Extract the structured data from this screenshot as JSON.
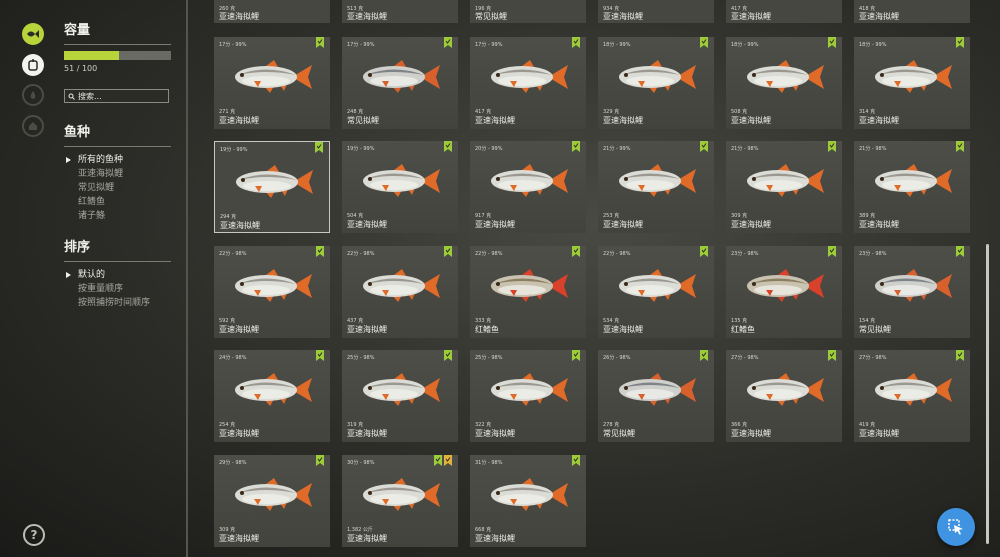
{
  "rail": {
    "icons": [
      "fish-tab-icon",
      "keepnet-icon",
      "fire-icon",
      "home-icon"
    ],
    "help_label": "?"
  },
  "capacity": {
    "title": "容量",
    "current": 51,
    "max": 100,
    "count_text": "51 / 100",
    "fill_fraction": 0.51
  },
  "search": {
    "placeholder": "搜索..."
  },
  "species_filter": {
    "title": "鱼种",
    "options": [
      "所有的鱼种",
      "亚速海拟鲤",
      "常见拟鲤",
      "红鳍鱼",
      "诸子鲦"
    ],
    "selected_index": 0
  },
  "sort": {
    "title": "排序",
    "options": [
      "默认的",
      "按重量顺序",
      "按照捕捞时间顺序"
    ],
    "selected_index": 0
  },
  "colors": {
    "accent": "#b7d43b",
    "cursor_button": "#3f93e0"
  },
  "top_row": [
    {
      "weight": "260 克",
      "species": "亚速海拟鲤"
    },
    {
      "weight": "513 克",
      "species": "亚速海拟鲤"
    },
    {
      "weight": "196 克",
      "species": "常见拟鲤"
    },
    {
      "weight": "934 克",
      "species": "亚速海拟鲤"
    },
    {
      "weight": "417 克",
      "species": "亚速海拟鲤"
    },
    {
      "weight": "418 克",
      "species": "亚速海拟鲤"
    }
  ],
  "catches": [
    {
      "time": "17分 - 99%",
      "weight": "271 克",
      "species": "亚速海拟鲤",
      "badges": [
        "green"
      ]
    },
    {
      "time": "17分 - 99%",
      "weight": "248 克",
      "species": "常见拟鲤",
      "badges": [
        "green"
      ]
    },
    {
      "time": "17分 - 99%",
      "weight": "417 克",
      "species": "亚速海拟鲤",
      "badges": [
        "green"
      ]
    },
    {
      "time": "18分 - 99%",
      "weight": "329 克",
      "species": "亚速海拟鲤",
      "badges": [
        "green"
      ]
    },
    {
      "time": "18分 - 99%",
      "weight": "508 克",
      "species": "亚速海拟鲤",
      "badges": [
        "green"
      ]
    },
    {
      "time": "18分 - 99%",
      "weight": "314 克",
      "species": "亚速海拟鲤",
      "badges": [
        "green"
      ]
    },
    {
      "time": "19分 - 99%",
      "weight": "294 克",
      "species": "亚速海拟鲤",
      "badges": [
        "green"
      ],
      "selected": true
    },
    {
      "time": "19分 - 99%",
      "weight": "504 克",
      "species": "亚速海拟鲤",
      "badges": [
        "green"
      ]
    },
    {
      "time": "20分 - 99%",
      "weight": "917 克",
      "species": "亚速海拟鲤",
      "badges": [
        "green"
      ]
    },
    {
      "time": "21分 - 99%",
      "weight": "253 克",
      "species": "亚速海拟鲤",
      "badges": [
        "green"
      ]
    },
    {
      "time": "21分 - 98%",
      "weight": "309 克",
      "species": "亚速海拟鲤",
      "badges": [
        "green"
      ]
    },
    {
      "time": "21分 - 98%",
      "weight": "389 克",
      "species": "亚速海拟鲤",
      "badges": [
        "green"
      ]
    },
    {
      "time": "22分 - 98%",
      "weight": "592 克",
      "species": "亚速海拟鲤",
      "badges": [
        "green"
      ]
    },
    {
      "time": "22分 - 98%",
      "weight": "437 克",
      "species": "亚速海拟鲤",
      "badges": [
        "green"
      ]
    },
    {
      "time": "22分 - 98%",
      "weight": "333 克",
      "species": "红鳍鱼",
      "badges": [
        "green"
      ]
    },
    {
      "time": "22分 - 98%",
      "weight": "534 克",
      "species": "亚速海拟鲤",
      "badges": [
        "green"
      ]
    },
    {
      "time": "23分 - 98%",
      "weight": "135 克",
      "species": "红鳍鱼",
      "badges": [
        "green"
      ]
    },
    {
      "time": "23分 - 98%",
      "weight": "154 克",
      "species": "常见拟鲤",
      "badges": [
        "green"
      ]
    },
    {
      "time": "24分 - 98%",
      "weight": "254 克",
      "species": "亚速海拟鲤",
      "badges": [
        "green"
      ]
    },
    {
      "time": "25分 - 98%",
      "weight": "319 克",
      "species": "亚速海拟鲤",
      "badges": [
        "green"
      ]
    },
    {
      "time": "25分 - 98%",
      "weight": "322 克",
      "species": "亚速海拟鲤",
      "badges": [
        "green"
      ]
    },
    {
      "time": "26分 - 98%",
      "weight": "278 克",
      "species": "常见拟鲤",
      "badges": [
        "green"
      ]
    },
    {
      "time": "27分 - 98%",
      "weight": "366 克",
      "species": "亚速海拟鲤",
      "badges": [
        "green"
      ]
    },
    {
      "time": "27分 - 98%",
      "weight": "419 克",
      "species": "亚速海拟鲤",
      "badges": [
        "green"
      ]
    },
    {
      "time": "29分 - 98%",
      "weight": "309 克",
      "species": "亚速海拟鲤",
      "badges": [
        "green"
      ]
    },
    {
      "time": "30分 - 98%",
      "weight": "1,382 公斤",
      "species": "亚速海拟鲤",
      "badges": [
        "green",
        "gold"
      ]
    },
    {
      "time": "31分 - 98%",
      "weight": "668 克",
      "species": "亚速海拟鲤",
      "badges": [
        "green"
      ]
    }
  ]
}
